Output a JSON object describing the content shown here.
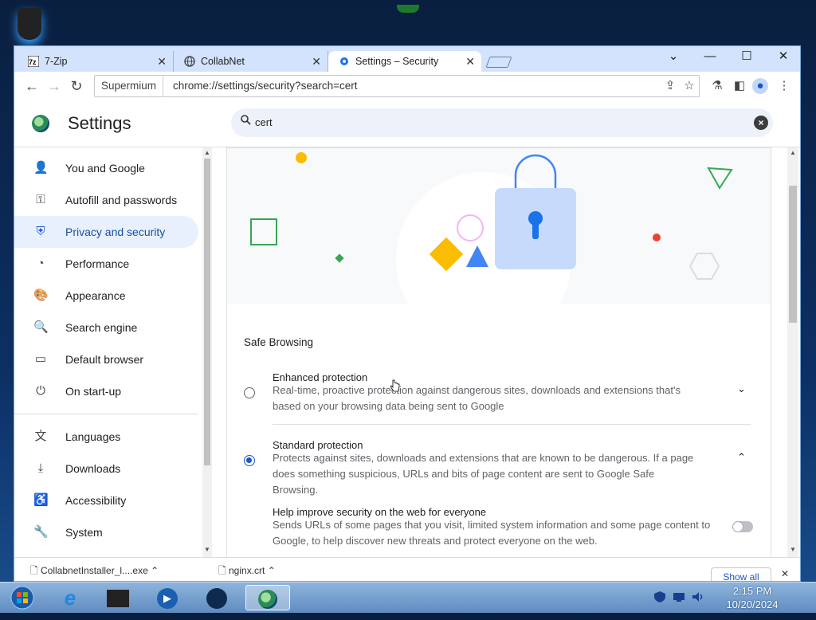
{
  "browser": {
    "tabs": [
      {
        "label": "7-Zip",
        "icon": "7zip-icon"
      },
      {
        "label": "CollabNet",
        "icon": "globe-icon"
      },
      {
        "label": "Settings – Security",
        "icon": "gear-icon"
      }
    ],
    "omnibox": {
      "chip": "Supermium",
      "url": "chrome://settings/security?search=cert"
    }
  },
  "settings": {
    "title": "Settings",
    "search": {
      "value": "cert",
      "clear_icon": "×"
    },
    "sidebar": [
      {
        "label": "You and Google",
        "icon": "person-icon",
        "active": false
      },
      {
        "label": "Autofill and passwords",
        "icon": "key-icon",
        "active": false
      },
      {
        "label": "Privacy and security",
        "icon": "shield-icon",
        "active": true
      },
      {
        "label": "Performance",
        "icon": "speedometer-icon",
        "active": false
      },
      {
        "label": "Appearance",
        "icon": "palette-icon",
        "active": false
      },
      {
        "label": "Search engine",
        "icon": "search-icon",
        "active": false
      },
      {
        "label": "Default browser",
        "icon": "browser-icon",
        "active": false
      },
      {
        "label": "On start-up",
        "icon": "power-icon",
        "active": false
      },
      {
        "label": "Languages",
        "icon": "translate-icon",
        "active": false
      },
      {
        "label": "Downloads",
        "icon": "download-icon",
        "active": false
      },
      {
        "label": "Accessibility",
        "icon": "accessibility-icon",
        "active": false
      },
      {
        "label": "System",
        "icon": "wrench-icon",
        "active": false
      }
    ],
    "safe_browsing": {
      "section_title": "Safe Browsing",
      "enhanced": {
        "title": "Enhanced protection",
        "desc": "Real-time, proactive protection against dangerous sites, downloads and extensions that's based on your browsing data being sent to Google",
        "selected": false
      },
      "standard": {
        "title": "Standard protection",
        "desc": "Protects against sites, downloads and extensions that are known to be dangerous. If a page does something suspicious, URLs and bits of page content are sent to Google Safe Browsing.",
        "selected": true
      },
      "help_improve": {
        "title": "Help improve security on the web for everyone",
        "desc": "Sends URLs of some pages that you visit, limited system information and some page content to Google, to help discover new threats and protect everyone on the web.",
        "enabled": false
      }
    }
  },
  "downloads_bar": {
    "items": [
      "CollabnetInstaller_l....exe",
      "nginx.crt"
    ],
    "show_all": "Show all"
  },
  "taskbar": {
    "time": "2:15 PM",
    "date": "10/20/2024"
  },
  "colors": {
    "accent": "#1a56c8",
    "active_bg": "#e8f0fe",
    "tabstrip": "#d3e3fd"
  }
}
